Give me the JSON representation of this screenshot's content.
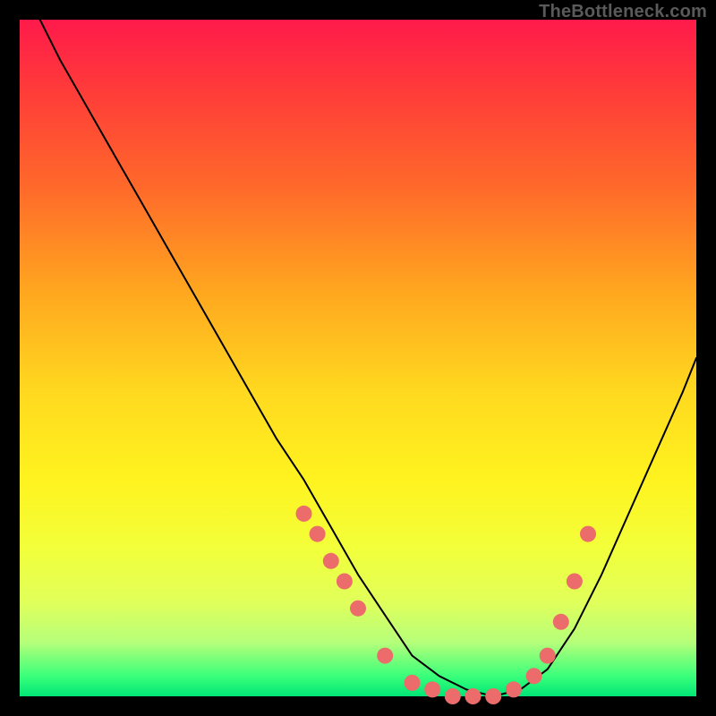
{
  "watermark": "TheBottleneck.com",
  "chart_data": {
    "type": "line",
    "title": "",
    "xlabel": "",
    "ylabel": "",
    "xlim": [
      0,
      100
    ],
    "ylim": [
      0,
      100
    ],
    "x": [
      3,
      6,
      10,
      14,
      18,
      22,
      26,
      30,
      34,
      38,
      42,
      46,
      50,
      54,
      58,
      62,
      66,
      70,
      74,
      78,
      82,
      86,
      90,
      94,
      98,
      100
    ],
    "values": [
      100,
      94,
      87,
      80,
      73,
      66,
      59,
      52,
      45,
      38,
      32,
      25,
      18,
      12,
      6,
      3,
      1,
      0,
      1,
      4,
      10,
      18,
      27,
      36,
      45,
      50
    ],
    "markers": {
      "x": [
        42,
        44,
        46,
        48,
        50,
        54,
        58,
        61,
        64,
        67,
        70,
        73,
        76,
        78,
        80,
        82,
        84
      ],
      "y": [
        27,
        24,
        20,
        17,
        13,
        6,
        2,
        1,
        0,
        0,
        0,
        1,
        3,
        6,
        11,
        17,
        24
      ],
      "color": "#ec6b6b",
      "size": 9
    },
    "line_color": "#000000",
    "line_width": 2
  }
}
